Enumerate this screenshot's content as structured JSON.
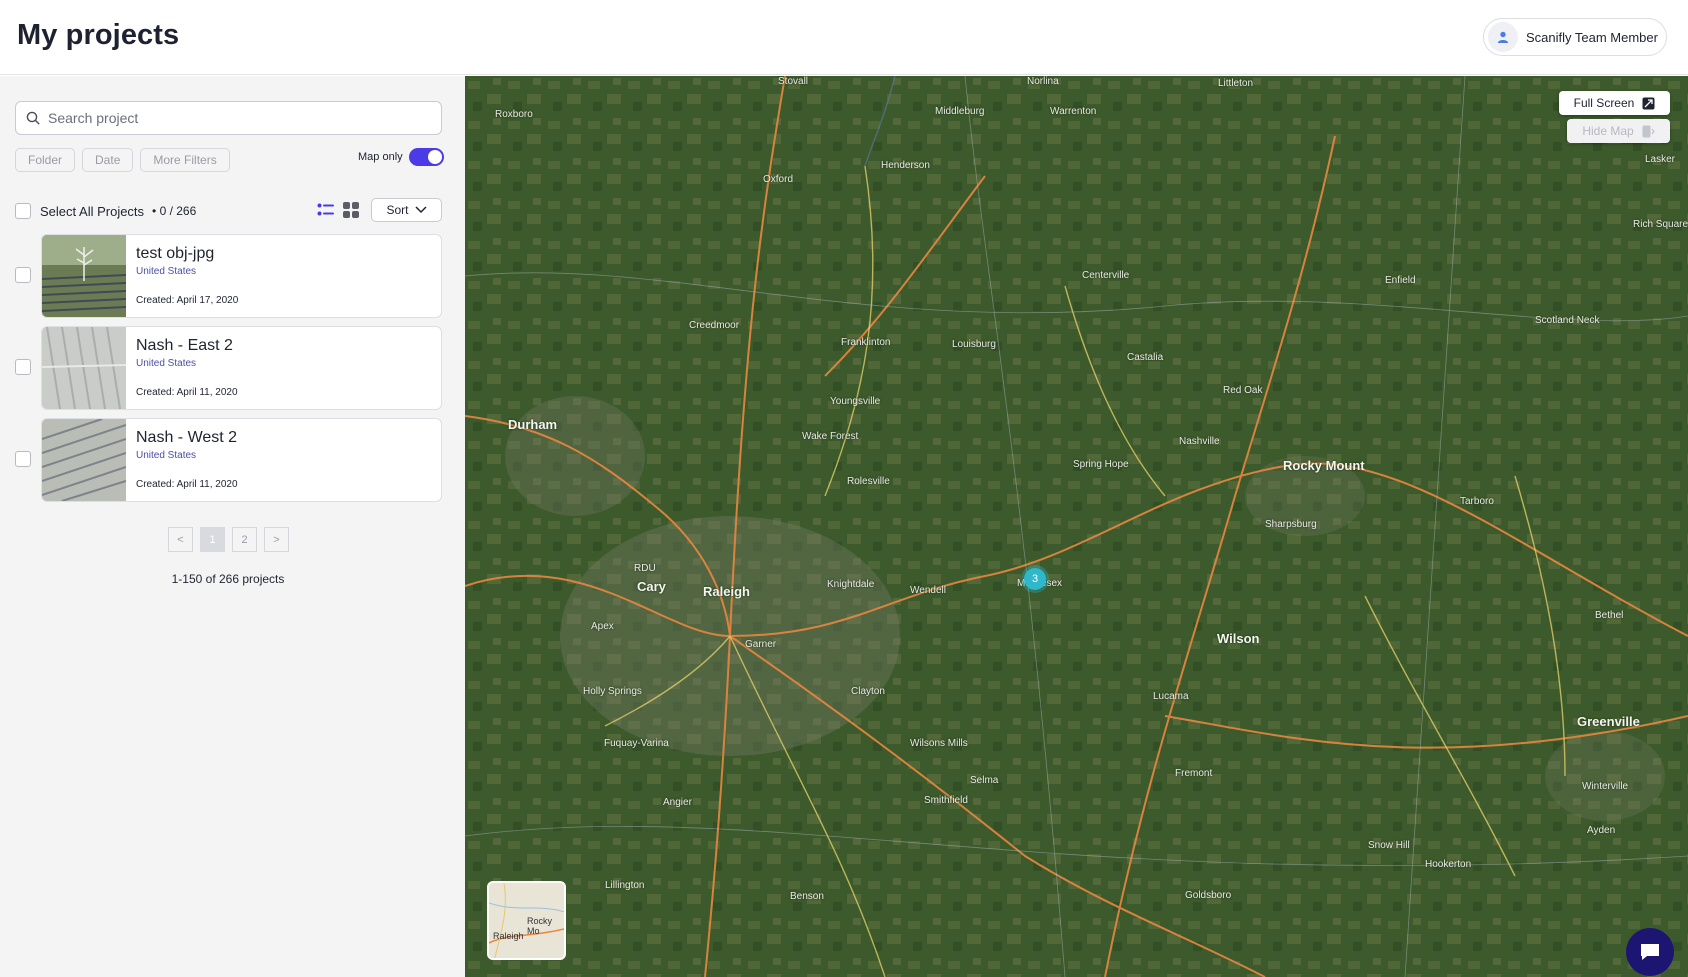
{
  "header": {
    "title": "My projects",
    "user_name": "Scanifly Team Member"
  },
  "search": {
    "placeholder": "Search project",
    "value": ""
  },
  "filters": {
    "folder": "Folder",
    "date": "Date",
    "more": "More Filters"
  },
  "map_only": {
    "label": "Map only",
    "enabled": true
  },
  "selection": {
    "label": "Select All Projects",
    "count": "• 0 / 266"
  },
  "sort": {
    "label": "Sort"
  },
  "projects": [
    {
      "title": "test obj-jpg",
      "country": "United States",
      "created": "Created: April 17, 2020"
    },
    {
      "title": "Nash - East 2",
      "country": "United States",
      "created": "Created: April 11, 2020"
    },
    {
      "title": "Nash - West 2",
      "country": "United States",
      "created": "Created: April 11, 2020"
    }
  ],
  "pagination": {
    "prev": "<",
    "pages": [
      "1",
      "2"
    ],
    "next": ">",
    "current": "1",
    "summary": "1-150 of 266 projects"
  },
  "map": {
    "full_screen": "Full Screen",
    "hide_map": "Hide Map",
    "cluster_count": "3",
    "cities": [
      "Durham",
      "Raleigh",
      "Cary",
      "Rocky Mount",
      "Wilson",
      "Greenville"
    ],
    "towns": [
      "Roxboro",
      "Oxford",
      "Henderson",
      "Middleburg",
      "Warrenton",
      "Norlina",
      "Littleton",
      "Creedmoor",
      "Franklinton",
      "Louisburg",
      "Centerville",
      "Castalia",
      "Enfield",
      "Scotland Neck",
      "Red Oak",
      "Nashville",
      "Spring Hope",
      "Youngsville",
      "Wake Forest",
      "Rolesville",
      "Knightdale",
      "Wendell",
      "Middlesex",
      "Sharpsburg",
      "Tarboro",
      "Apex",
      "Garner",
      "Holly Springs",
      "Clayton",
      "Fuquay-Varina",
      "Wilsons Mills",
      "Selma",
      "Smithfield",
      "Lucama",
      "Fremont",
      "Angier",
      "Lillington",
      "Benson",
      "Goldsboro",
      "Snow Hill",
      "Hookerton",
      "Ayden",
      "Winterville",
      "Bethel",
      "Lasker",
      "Rich Square",
      "Stovall",
      "RDU"
    ],
    "minimap": {
      "labels": [
        "Raleigh",
        "Rocky Mo"
      ]
    }
  },
  "colors": {
    "accent": "#4a3be6",
    "cluster": "#2fb8c9",
    "chat": "#1c1672"
  }
}
